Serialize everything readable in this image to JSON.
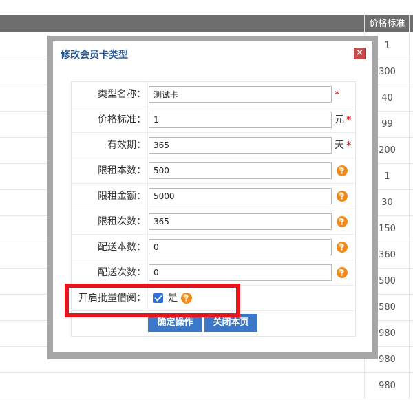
{
  "table": {
    "header": "价格标准",
    "prices": [
      "1",
      "300",
      "40",
      "99",
      "200",
      "1",
      "30",
      "150",
      "360",
      "500",
      "580",
      "980",
      "980",
      "980"
    ]
  },
  "modal": {
    "title": "修改会员卡类型",
    "close_label": "×",
    "fields": [
      {
        "label": "类型名称：",
        "value": "测试卡",
        "unit": "",
        "required": "*"
      },
      {
        "label": "价格标准：",
        "value": "1",
        "unit": "元",
        "required": "*"
      },
      {
        "label": "有效期：",
        "value": "365",
        "unit": "天",
        "required": "*"
      },
      {
        "label": "限租本数：",
        "value": "500",
        "icon": "help-icon"
      },
      {
        "label": "限租金额：",
        "value": "5000",
        "icon": "help-icon"
      },
      {
        "label": "限租次数：",
        "value": "365",
        "icon": "help-icon"
      },
      {
        "label": "配送本数：",
        "value": "0",
        "icon": "help-icon"
      },
      {
        "label": "配送次数：",
        "value": "0",
        "icon": "help-icon"
      }
    ],
    "batch_borrow": {
      "label": "开启批量借阅：",
      "checked": true,
      "option": "是"
    },
    "buttons": {
      "confirm": "确定操作",
      "close": "关闭本页"
    }
  },
  "colors": {
    "accent": "#3b78c7",
    "title": "#2a5a95",
    "required": "#d00000",
    "highlight": "#e8141c"
  }
}
